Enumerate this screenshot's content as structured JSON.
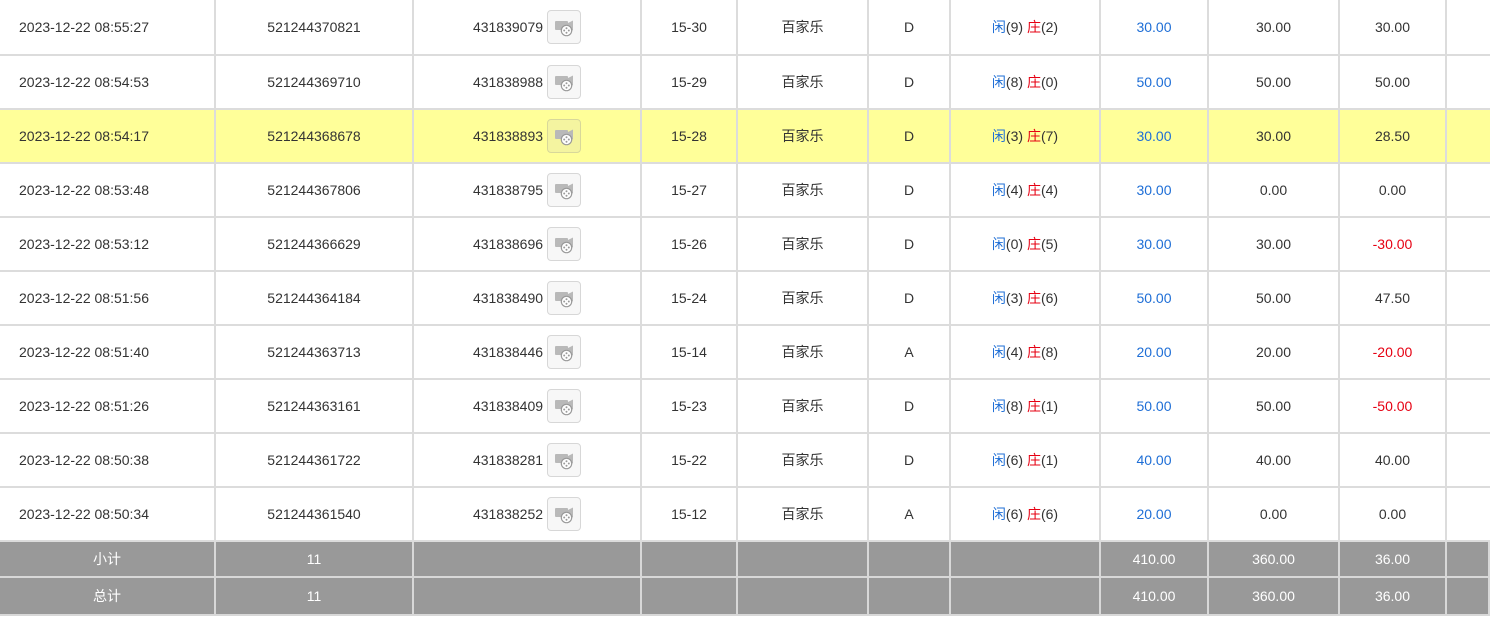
{
  "rows": [
    {
      "time": "2023-12-22 08:55:27",
      "order_no": "521244370821",
      "game_no": "431839079",
      "shoe": "15-30",
      "game": "百家乐",
      "table": "D",
      "player_label": "闲",
      "player_points": "(9)",
      "banker_label": "庄",
      "banker_points": "(2)",
      "bet": "30.00",
      "valid_bet": "30.00",
      "win_loss": "30.00",
      "negative": false,
      "highlight": false
    },
    {
      "time": "2023-12-22 08:54:53",
      "order_no": "521244369710",
      "game_no": "431838988",
      "shoe": "15-29",
      "game": "百家乐",
      "table": "D",
      "player_label": "闲",
      "player_points": "(8)",
      "banker_label": "庄",
      "banker_points": "(0)",
      "bet": "50.00",
      "valid_bet": "50.00",
      "win_loss": "50.00",
      "negative": false,
      "highlight": false
    },
    {
      "time": "2023-12-22 08:54:17",
      "order_no": "521244368678",
      "game_no": "431838893",
      "shoe": "15-28",
      "game": "百家乐",
      "table": "D",
      "player_label": "闲",
      "player_points": "(3)",
      "banker_label": "庄",
      "banker_points": "(7)",
      "bet": "30.00",
      "valid_bet": "30.00",
      "win_loss": "28.50",
      "negative": false,
      "highlight": true
    },
    {
      "time": "2023-12-22 08:53:48",
      "order_no": "521244367806",
      "game_no": "431838795",
      "shoe": "15-27",
      "game": "百家乐",
      "table": "D",
      "player_label": "闲",
      "player_points": "(4)",
      "banker_label": "庄",
      "banker_points": "(4)",
      "bet": "30.00",
      "valid_bet": "0.00",
      "win_loss": "0.00",
      "negative": false,
      "highlight": false
    },
    {
      "time": "2023-12-22 08:53:12",
      "order_no": "521244366629",
      "game_no": "431838696",
      "shoe": "15-26",
      "game": "百家乐",
      "table": "D",
      "player_label": "闲",
      "player_points": "(0)",
      "banker_label": "庄",
      "banker_points": "(5)",
      "bet": "30.00",
      "valid_bet": "30.00",
      "win_loss": "-30.00",
      "negative": true,
      "highlight": false
    },
    {
      "time": "2023-12-22 08:51:56",
      "order_no": "521244364184",
      "game_no": "431838490",
      "shoe": "15-24",
      "game": "百家乐",
      "table": "D",
      "player_label": "闲",
      "player_points": "(3)",
      "banker_label": "庄",
      "banker_points": "(6)",
      "bet": "50.00",
      "valid_bet": "50.00",
      "win_loss": "47.50",
      "negative": false,
      "highlight": false
    },
    {
      "time": "2023-12-22 08:51:40",
      "order_no": "521244363713",
      "game_no": "431838446",
      "shoe": "15-14",
      "game": "百家乐",
      "table": "A",
      "player_label": "闲",
      "player_points": "(4)",
      "banker_label": "庄",
      "banker_points": "(8)",
      "bet": "20.00",
      "valid_bet": "20.00",
      "win_loss": "-20.00",
      "negative": true,
      "highlight": false
    },
    {
      "time": "2023-12-22 08:51:26",
      "order_no": "521244363161",
      "game_no": "431838409",
      "shoe": "15-23",
      "game": "百家乐",
      "table": "D",
      "player_label": "闲",
      "player_points": "(8)",
      "banker_label": "庄",
      "banker_points": "(1)",
      "bet": "50.00",
      "valid_bet": "50.00",
      "win_loss": "-50.00",
      "negative": true,
      "highlight": false
    },
    {
      "time": "2023-12-22 08:50:38",
      "order_no": "521244361722",
      "game_no": "431838281",
      "shoe": "15-22",
      "game": "百家乐",
      "table": "D",
      "player_label": "闲",
      "player_points": "(6)",
      "banker_label": "庄",
      "banker_points": "(1)",
      "bet": "40.00",
      "valid_bet": "40.00",
      "win_loss": "40.00",
      "negative": false,
      "highlight": false
    },
    {
      "time": "2023-12-22 08:50:34",
      "order_no": "521244361540",
      "game_no": "431838252",
      "shoe": "15-12",
      "game": "百家乐",
      "table": "A",
      "player_label": "闲",
      "player_points": "(6)",
      "banker_label": "庄",
      "banker_points": "(6)",
      "bet": "20.00",
      "valid_bet": "0.00",
      "win_loss": "0.00",
      "negative": false,
      "highlight": false
    }
  ],
  "subtotal": {
    "label": "小计",
    "count": "11",
    "bet": "410.00",
    "valid_bet": "360.00",
    "win_loss": "36.00"
  },
  "total": {
    "label": "总计",
    "count": "11",
    "bet": "410.00",
    "valid_bet": "360.00",
    "win_loss": "36.00"
  },
  "colors": {
    "highlight": "#ffff99",
    "player": "#1e6ed6",
    "banker": "#e60012",
    "negative": "#e60012",
    "summary_bg": "#999999"
  },
  "icons": {
    "video": "video-replay-icon"
  }
}
